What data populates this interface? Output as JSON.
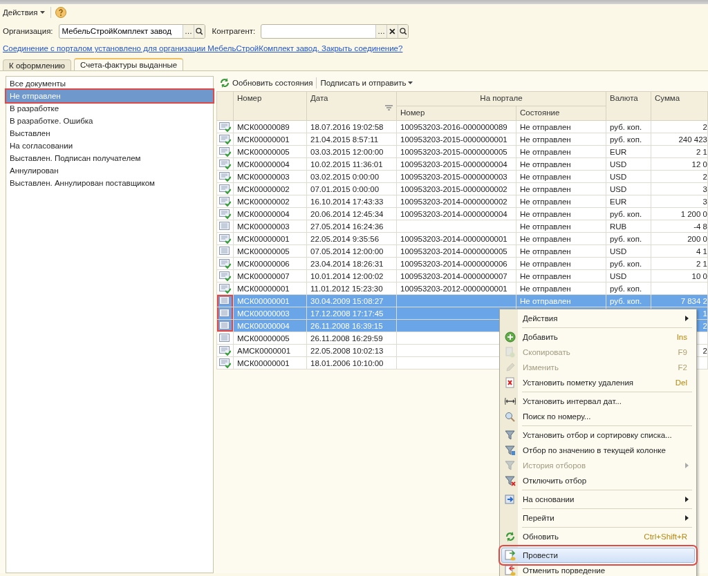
{
  "toolbar": {
    "actions": "Действия"
  },
  "filters": {
    "organization": {
      "label": "Организация:",
      "value": "МебельСтройКомплект завод",
      "select_button": "…"
    },
    "counterparty": {
      "label": "Контрагент:",
      "select_button": "…"
    }
  },
  "connection_link": "Соединение с порталом установлено для организации МебельСтройКомплект завод. Закрыть соединение?",
  "tabs": [
    {
      "label": "К оформлению",
      "selected": false
    },
    {
      "label": "Счета-фактуры выданные",
      "selected": true
    }
  ],
  "status_list": [
    {
      "label": "Все документы",
      "selected": false,
      "highlighted": false
    },
    {
      "label": "Не отправлен",
      "selected": true,
      "highlighted": true
    },
    {
      "label": "В разработке",
      "selected": false,
      "highlighted": false
    },
    {
      "label": "В разработке. Ошибка",
      "selected": false,
      "highlighted": false
    },
    {
      "label": "Выставлен",
      "selected": false,
      "highlighted": false
    },
    {
      "label": "На согласовании",
      "selected": false,
      "highlighted": false
    },
    {
      "label": "Выставлен. Подписан получателем",
      "selected": false,
      "highlighted": false
    },
    {
      "label": "Аннулирован",
      "selected": false,
      "highlighted": false
    },
    {
      "label": "Выставлен. Аннулирован поставщиком",
      "selected": false,
      "highlighted": false
    }
  ],
  "list_toolbar": {
    "refresh": "Ообновить состояния",
    "sign_send": "Подписать и отправить"
  },
  "table": {
    "columns": {
      "number": "Номер",
      "date": "Дата",
      "portal": "На портале",
      "portal_number": "Номер",
      "portal_state": "Состояние",
      "currency": "Валюта",
      "sum": "Сумма"
    },
    "rows": [
      {
        "posted": true,
        "selected": false,
        "highlighted": false,
        "number": "МСК00000089",
        "date": "18.07.2016 19:02:58",
        "portal_number": "100953203-2016-0000000089",
        "state": "Не отправлен",
        "currency": "руб. коп.",
        "sum": "2"
      },
      {
        "posted": true,
        "selected": false,
        "highlighted": false,
        "number": "МСК00000001",
        "date": "21.04.2015 8:57:11",
        "portal_number": "100953203-2015-0000000001",
        "state": "Не отправлен",
        "currency": "руб. коп.",
        "sum": "240 423"
      },
      {
        "posted": true,
        "selected": false,
        "highlighted": false,
        "number": "МСК00000005",
        "date": "03.03.2015 12:00:00",
        "portal_number": "100953203-2015-0000000005",
        "state": "Не отправлен",
        "currency": "EUR",
        "sum": "2 1"
      },
      {
        "posted": true,
        "selected": false,
        "highlighted": false,
        "number": "МСК00000004",
        "date": "10.02.2015 11:36:01",
        "portal_number": "100953203-2015-0000000004",
        "state": "Не отправлен",
        "currency": "USD",
        "sum": "12 0"
      },
      {
        "posted": true,
        "selected": false,
        "highlighted": false,
        "number": "МСК00000003",
        "date": "03.02.2015 0:00:00",
        "portal_number": "100953203-2015-0000000003",
        "state": "Не отправлен",
        "currency": "USD",
        "sum": "2"
      },
      {
        "posted": true,
        "selected": false,
        "highlighted": false,
        "number": "МСК00000002",
        "date": "07.01.2015 0:00:00",
        "portal_number": "100953203-2015-0000000002",
        "state": "Не отправлен",
        "currency": "USD",
        "sum": "3"
      },
      {
        "posted": true,
        "selected": false,
        "highlighted": false,
        "number": "МСК00000002",
        "date": "16.10.2014 17:43:33",
        "portal_number": "100953203-2014-0000000002",
        "state": "Не отправлен",
        "currency": "EUR",
        "sum": "3"
      },
      {
        "posted": true,
        "selected": false,
        "highlighted": false,
        "number": "МСК00000004",
        "date": "20.06.2014 12:45:34",
        "portal_number": "100953203-2014-0000000004",
        "state": "Не отправлен",
        "currency": "руб. коп.",
        "sum": "1 200 0"
      },
      {
        "posted": false,
        "selected": false,
        "highlighted": false,
        "number": "МСК00000003",
        "date": "27.05.2014 16:24:36",
        "state": "Не отправлен",
        "currency": "RUB",
        "sum": "-4 8"
      },
      {
        "posted": true,
        "selected": false,
        "highlighted": false,
        "number": "МСК00000001",
        "date": "22.05.2014 9:35:56",
        "portal_number": "100953203-2014-0000000001",
        "state": "Не отправлен",
        "currency": "руб. коп.",
        "sum": "200 0"
      },
      {
        "posted": false,
        "selected": false,
        "highlighted": false,
        "number": "МСК00000005",
        "date": "07.05.2014 12:00:00",
        "portal_number": "100953203-2014-0000000005",
        "state": "Не отправлен",
        "currency": "USD",
        "sum": "4 1"
      },
      {
        "posted": true,
        "selected": false,
        "highlighted": false,
        "number": "МСК00000006",
        "date": "23.04.2014 18:26:31",
        "portal_number": "100953203-2014-0000000006",
        "state": "Не отправлен",
        "currency": "руб. коп.",
        "sum": "2 1"
      },
      {
        "posted": true,
        "selected": false,
        "highlighted": false,
        "number": "МСК00000007",
        "date": "10.01.2014 12:00:02",
        "portal_number": "100953203-2014-0000000007",
        "state": "Не отправлен",
        "currency": "USD",
        "sum": "10 0"
      },
      {
        "posted": true,
        "selected": false,
        "highlighted": false,
        "number": "МСК00000001",
        "date": "11.01.2012 15:23:30",
        "portal_number": "100953203-2012-0000000001",
        "state": "Не отправлен",
        "currency": "руб. коп."
      },
      {
        "posted": false,
        "selected": true,
        "highlighted": true,
        "number": "МСК00000001",
        "date": "30.04.2009 15:08:27",
        "state": "Не отправлен",
        "currency": "руб. коп.",
        "sum": "7 834 2"
      },
      {
        "posted": false,
        "selected": true,
        "highlighted": true,
        "number": "МСК00000003",
        "date": "17.12.2008 17:17:45",
        "sum": "1"
      },
      {
        "posted": false,
        "selected": true,
        "highlighted": true,
        "number": "МСК00000004",
        "date": "26.11.2008 16:39:15",
        "sum": "2"
      },
      {
        "posted": false,
        "selected": false,
        "highlighted": false,
        "number": "МСК00000005",
        "date": "26.11.2008 16:29:59"
      },
      {
        "posted": true,
        "selected": false,
        "highlighted": false,
        "number": "АМСК0000001",
        "date": "22.05.2008 10:02:13",
        "sum": "2"
      },
      {
        "posted": true,
        "selected": false,
        "highlighted": false,
        "number": "МСК00000001",
        "date": "18.01.2006 10:10:00"
      }
    ]
  },
  "context_menu": [
    {
      "kind": "item",
      "label": "Действия",
      "disabled": false,
      "submenu": true,
      "selected": false,
      "highlighted": false
    },
    {
      "kind": "separator"
    },
    {
      "kind": "item",
      "label": "Добавить",
      "shortcut": "Ins",
      "disabled": false,
      "submenu": false,
      "selected": false,
      "highlighted": false
    },
    {
      "kind": "item",
      "label": "Скопировать",
      "shortcut": "F9",
      "disabled": true,
      "submenu": false,
      "selected": false,
      "highlighted": false
    },
    {
      "kind": "item",
      "label": "Изменить",
      "shortcut": "F2",
      "disabled": true,
      "submenu": false,
      "selected": false,
      "highlighted": false
    },
    {
      "kind": "item",
      "label": "Установить пометку удаления",
      "shortcut": "Del",
      "disabled": false,
      "submenu": false,
      "selected": false,
      "highlighted": false
    },
    {
      "kind": "separator"
    },
    {
      "kind": "item",
      "label": "Установить интервал дат...",
      "disabled": false,
      "submenu": false,
      "selected": false,
      "highlighted": false
    },
    {
      "kind": "item",
      "label": "Поиск по номеру...",
      "disabled": false,
      "submenu": false,
      "selected": false,
      "highlighted": false
    },
    {
      "kind": "separator"
    },
    {
      "kind": "item",
      "label": "Установить отбор и сортировку списка...",
      "disabled": false,
      "submenu": false,
      "selected": false,
      "highlighted": false
    },
    {
      "kind": "item",
      "label": "Отбор по значению в текущей колонке",
      "disabled": false,
      "submenu": false,
      "selected": false,
      "highlighted": false
    },
    {
      "kind": "item",
      "label": "История отборов",
      "disabled": true,
      "submenu": true,
      "selected": false,
      "highlighted": false
    },
    {
      "kind": "item",
      "label": "Отключить отбор",
      "disabled": false,
      "submenu": false,
      "selected": false,
      "highlighted": false
    },
    {
      "kind": "separator"
    },
    {
      "kind": "item",
      "label": "На основании",
      "disabled": false,
      "submenu": true,
      "selected": false,
      "highlighted": false
    },
    {
      "kind": "separator"
    },
    {
      "kind": "item",
      "label": "Перейти",
      "disabled": false,
      "submenu": true,
      "selected": false,
      "highlighted": false
    },
    {
      "kind": "separator"
    },
    {
      "kind": "item",
      "label": "Обновить",
      "shortcut": "Ctrl+Shift+R",
      "disabled": false,
      "submenu": false,
      "selected": false,
      "highlighted": false
    },
    {
      "kind": "separator"
    },
    {
      "kind": "item",
      "label": "Провести",
      "disabled": false,
      "submenu": false,
      "selected": true,
      "highlighted": true
    },
    {
      "kind": "item",
      "label": "Отменить порведение",
      "disabled": false,
      "submenu": false,
      "selected": false,
      "highlighted": false
    }
  ]
}
